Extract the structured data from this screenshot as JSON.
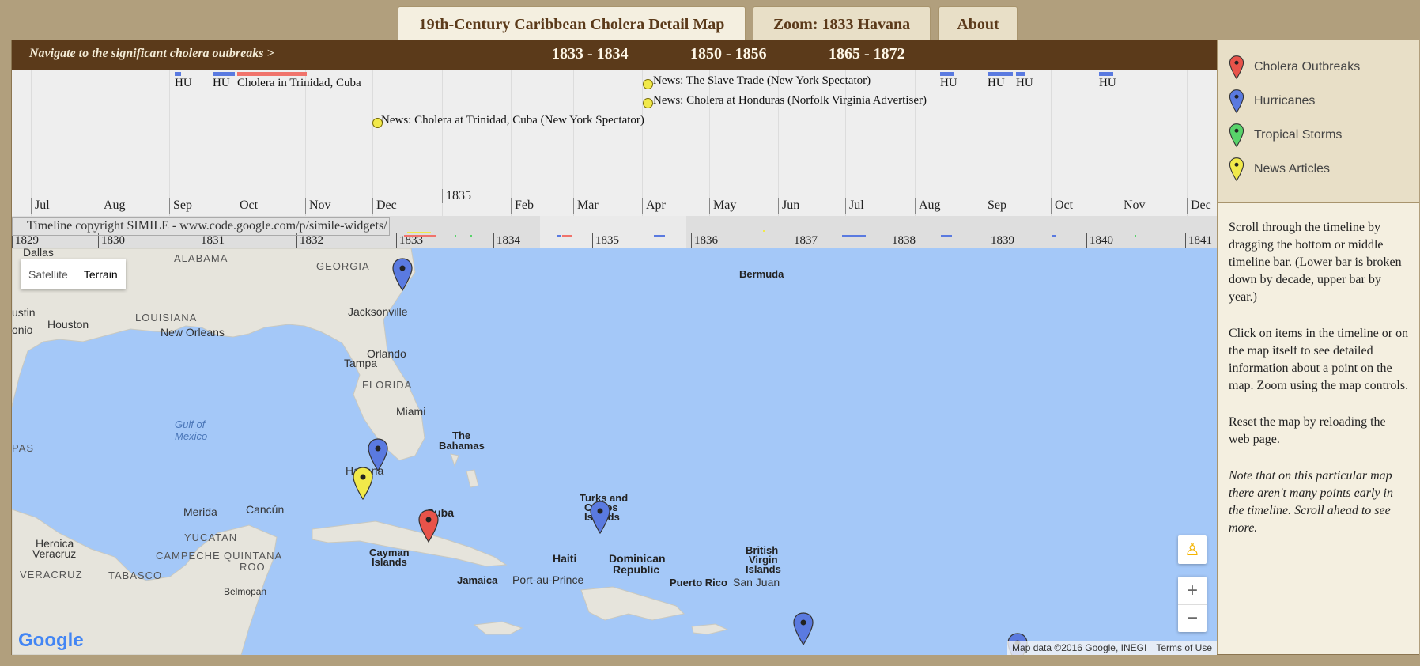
{
  "tabs": [
    {
      "label": "19th-Century Caribbean Cholera Detail Map",
      "active": true
    },
    {
      "label": "Zoom: 1833 Havana",
      "active": false
    },
    {
      "label": "About",
      "active": false
    }
  ],
  "navbar": {
    "prompt": "Navigate to the significant cholera outbreaks >",
    "ranges": [
      "1833 - 1834",
      "1850 - 1856",
      "1865 - 1872"
    ]
  },
  "timeline": {
    "months": [
      "Jul",
      "Aug",
      "Sep",
      "Oct",
      "Nov",
      "Dec",
      "Feb",
      "Mar",
      "Apr",
      "May",
      "Jun",
      "Jul",
      "Aug",
      "Sep",
      "Oct",
      "Nov",
      "Dec"
    ],
    "year_label": "1835",
    "events": {
      "hu1": "HU",
      "hu2": "HU",
      "cholera_trinidad": "Cholera in Trinidad, Cuba",
      "news_trinidad": "News: Cholera at Trinidad, Cuba (New York Spectator)",
      "news_slave": "News: The Slave Trade (New York Spectator)",
      "news_honduras": "News: Cholera at Honduras (Norfolk Virginia Advertiser)",
      "hu3": "HU",
      "hu4": "HU",
      "hu5": "HU",
      "hu6": "HU"
    }
  },
  "overview": {
    "broken_image_alt": "Timeline copyright SIMILE - www.code.google.com/p/simile-widgets/",
    "years": [
      "1829",
      "1830",
      "1831",
      "1832",
      "1833",
      "1834",
      "1835",
      "1836",
      "1837",
      "1838",
      "1839",
      "1840",
      "1841"
    ]
  },
  "map": {
    "type_buttons": {
      "satellite": "Satellite",
      "terrain": "Terrain"
    },
    "labels": {
      "dallas": "Dallas",
      "alabama": "ALABAMA",
      "georgia": "GEORGIA",
      "bermuda": "Bermuda",
      "austin": "ustin",
      "louisiana": "LOUISIANA",
      "houston": "Houston",
      "new_orleans": "New Orleans",
      "jacksonville": "Jacksonville",
      "antonio": "onio",
      "orlando": "Orlando",
      "tampa": "Tampa",
      "florida": "FLORIDA",
      "miami": "Miami",
      "gulf": "Gulf of",
      "mexico": "Mexico",
      "pas": "PAS",
      "bahamas1": "The",
      "bahamas2": "Bahamas",
      "havana": "Havana",
      "cuba": "Cuba",
      "turks1": "Turks and",
      "turks2": "Caicos",
      "turks3": "Islands",
      "merida": "Merida",
      "cancun": "Cancún",
      "yucatan": "YUCATAN",
      "campeche": "CAMPECHE",
      "quintana1": "QUINTANA",
      "quintana2": "ROO",
      "heroica1": "Heroica",
      "heroica2": "Veracruz",
      "veracruz": "VERACRUZ",
      "tabasco": "TABASCO",
      "belmopan": "Belmopan",
      "cayman1": "Cayman",
      "cayman2": "Islands",
      "jamaica": "Jamaica",
      "haiti": "Haiti",
      "portauprince": "Port-au-Prince",
      "dominican1": "Dominican",
      "dominican2": "Republic",
      "bvi1": "British",
      "bvi2": "Virgin",
      "bvi3": "Islands",
      "puertorico": "Puerto Rico",
      "sanjuan": "San Juan"
    },
    "attribution": {
      "data": "Map data ©2016 Google, INEGI",
      "terms": "Terms of Use"
    },
    "logo": "Google",
    "colors": {
      "cholera": "#e8534a",
      "hurricane": "#5a7ae0",
      "tropical": "#58d36a",
      "news": "#f1e94a"
    }
  },
  "legend": [
    {
      "label": "Cholera Outbreaks",
      "color": "#e8534a"
    },
    {
      "label": "Hurricanes",
      "color": "#5a7ae0"
    },
    {
      "label": "Tropical Storms",
      "color": "#58d36a"
    },
    {
      "label": "News Articles",
      "color": "#f1e94a"
    }
  ],
  "help": {
    "p1": "Scroll through the timeline by dragging the bottom or middle timeline bar. (Lower bar is broken down by decade, upper bar by year.)",
    "p2": "Click on items in the timeline or on the map itself to see detailed information about a point on the map. Zoom using the map controls.",
    "p3": "Reset the map by reloading the web page.",
    "p4": "Note that on this particular map there aren't many points early in the timeline. Scroll ahead to see more."
  }
}
